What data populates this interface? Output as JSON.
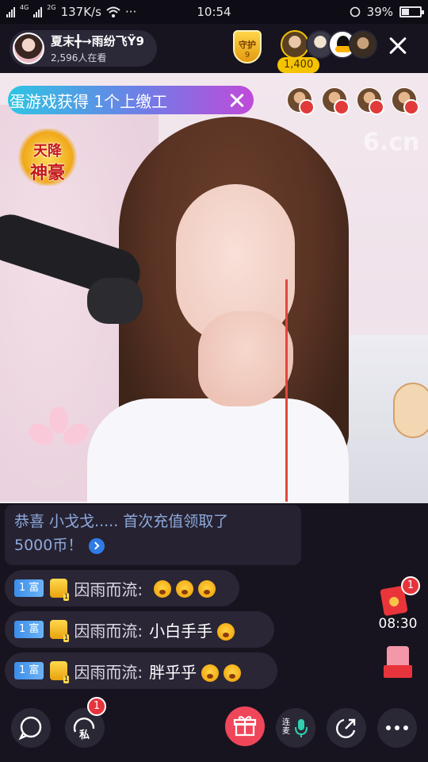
{
  "status_bar": {
    "network_speed": "137K/s",
    "signal_tag_1": "4G",
    "signal_tag_2": "2G",
    "time": "10:54",
    "battery_percent": "39%",
    "battery_level": 0.39
  },
  "header": {
    "host_name": "夏末╋→雨纷飞Ϋ9",
    "viewers": "2,596人在看",
    "guard_label": "守护",
    "guard_level": "9",
    "coin_count": "1,400"
  },
  "video": {
    "notice_text": "蛋游戏获得 1个上缴工",
    "gold_badge_top": "天降",
    "gold_badge_bottom": "神豪",
    "watermark": "6.cn"
  },
  "chat": {
    "congrats_line1": "恭喜 小戈戈..... 首次充值领取了",
    "congrats_line2": "5000币！",
    "messages": [
      {
        "level": "1 富",
        "user": "因雨而流:",
        "text": ""
      },
      {
        "level": "1 富",
        "user": "因雨而流:",
        "text": "小白手手"
      },
      {
        "level": "1 富",
        "user": "因雨而流:",
        "text": "胖乎乎"
      }
    ],
    "vip_level": "1"
  },
  "floaters": {
    "redpacket_count": "1",
    "timer": "08:30"
  },
  "bottom_bar": {
    "private_label": "私",
    "private_badge": "1",
    "mic_label": "连麦"
  },
  "colors": {
    "background": "#17141f",
    "accent_gift": "#f0465a",
    "badge_red": "#e7343c",
    "coin_gold": "#f5c400",
    "link_blue": "#8ea9dc"
  }
}
